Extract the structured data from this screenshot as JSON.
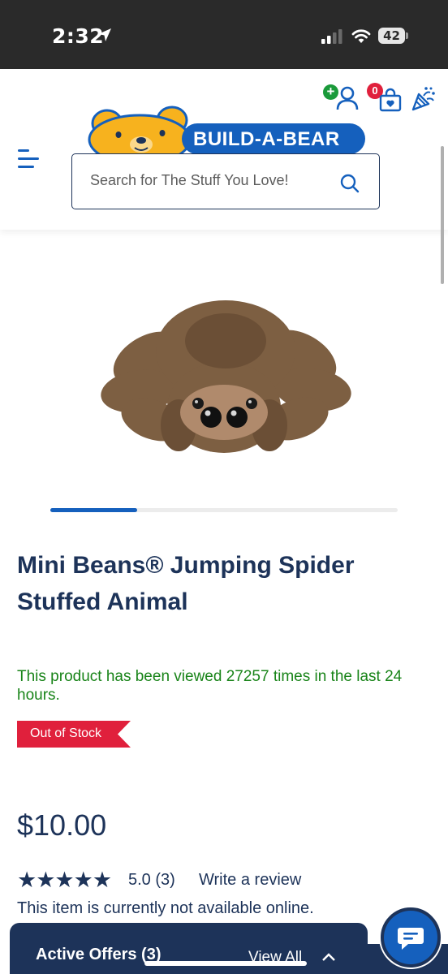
{
  "status_bar": {
    "time": "2:32",
    "battery": "42"
  },
  "header": {
    "brand": "BUILD-A-BEAR",
    "search_placeholder": "Search for The Stuff You Love!",
    "cart_count": "0",
    "account_badge": "+"
  },
  "product": {
    "title": "Mini Beans® Jumping Spider Stuffed Animal",
    "view_notice": "This product has been viewed 27257 times in the last 24 hours.",
    "stock_status": "Out of Stock",
    "price": "$10.00",
    "stars": "★★★★★",
    "rating": "5.0 (3)",
    "write_review": "Write a review",
    "availability": "This item is currently not available online.",
    "carousel_progress": 0.25
  },
  "offers": {
    "title": "Active Offers (3)",
    "view_all": "View All"
  },
  "colors": {
    "brand_blue": "#1560bd",
    "navy": "#1d3359",
    "success_green": "#198419",
    "alert_red": "#e0203c"
  },
  "icons": [
    "location-arrow-icon",
    "signal-icon",
    "wifi-icon",
    "battery-icon",
    "menu-icon",
    "account-icon",
    "cart-icon",
    "party-icon",
    "search-icon",
    "chevron-up-icon",
    "chat-icon"
  ]
}
